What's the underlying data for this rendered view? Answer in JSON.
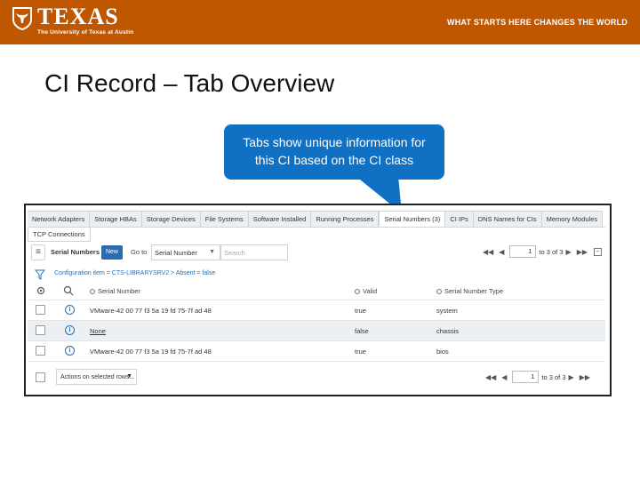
{
  "banner": {
    "logo_word": "TEXAS",
    "logo_sub": "The University of Texas at Austin",
    "tagline": "WHAT STARTS HERE CHANGES THE WORLD",
    "brand_color": "#bf5700"
  },
  "slide": {
    "title": "CI Record – Tab Overview"
  },
  "callout": {
    "line1": "Tabs show unique information for",
    "line2": "this CI based on the CI class",
    "color": "#1070c4"
  },
  "record": {
    "tabs": [
      {
        "label": "Network Adapters"
      },
      {
        "label": "Storage HBAs"
      },
      {
        "label": "Storage Devices"
      },
      {
        "label": "File Systems"
      },
      {
        "label": "Software Installed"
      },
      {
        "label": "Running Processes"
      },
      {
        "label": "Serial Numbers (3)",
        "active": true
      },
      {
        "label": "CI IPs"
      },
      {
        "label": "DNS Names for CIs"
      },
      {
        "label": "Memory Modules"
      }
    ],
    "tab_row2": "TCP Connections",
    "toolbar": {
      "list_title": "Serial Numbers",
      "new_label": "New",
      "goto_label": "Go to",
      "field_select": "Serial Number",
      "search_placeholder": "Search",
      "page_value": "1",
      "page_info": "to 3 of 3"
    },
    "breadcrumb": "Configuration item = CTS-LIBRARYSRV2 > Absent = false",
    "columns": {
      "serial": "Serial Number",
      "valid": "Valid",
      "type": "Serial Number Type"
    },
    "rows": [
      {
        "serial": "VMware-42 00 77 f3 5a 19 fd 75-7f ad 48",
        "valid": "true",
        "type": "system",
        "link": false
      },
      {
        "serial": "None",
        "valid": "false",
        "type": "chassis",
        "link": true
      },
      {
        "serial": "VMware-42 00 77 f3 5a 19 fd 75-7f ad 48",
        "valid": "true",
        "type": "bios",
        "link": false
      }
    ],
    "footer": {
      "actions_label": "Actions on selected rows...",
      "page_value": "1",
      "page_info": "to 3 of 3"
    }
  }
}
